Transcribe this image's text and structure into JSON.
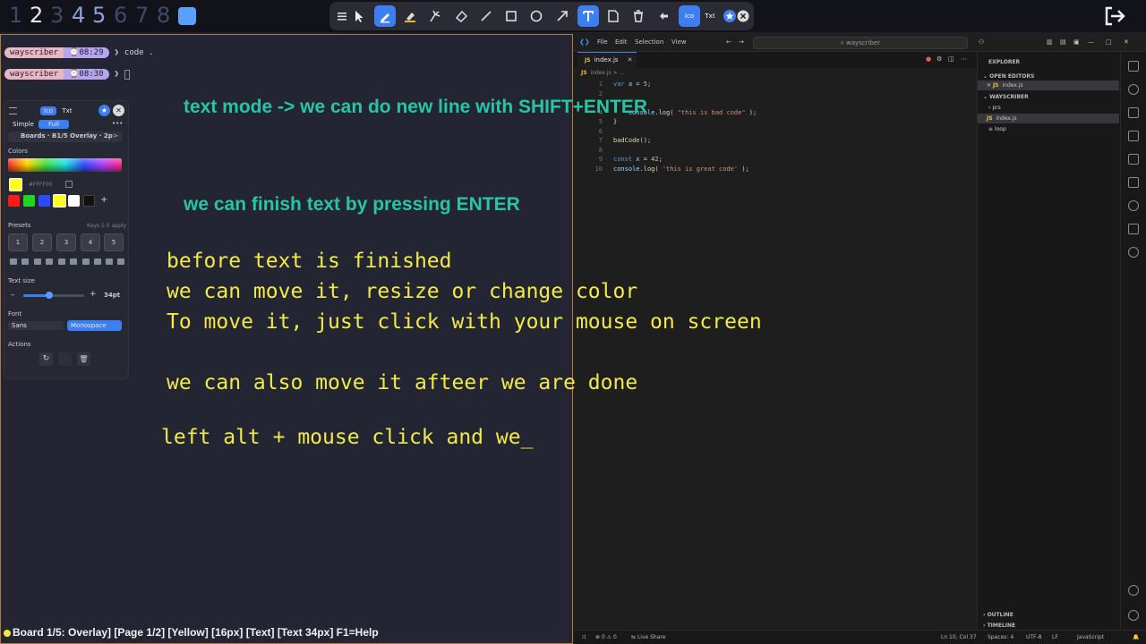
{
  "workspaces": {
    "items": [
      "1",
      "2",
      "3",
      "4",
      "5",
      "6",
      "7",
      "8"
    ],
    "active": "2"
  },
  "toolbar": {
    "icon_mode_label": "Ico",
    "text_mode_label": "Txt"
  },
  "terminal": {
    "host": "wayscriber",
    "rows": [
      {
        "time": "08:29",
        "command": "code ."
      },
      {
        "time": "08:30",
        "command": ""
      }
    ]
  },
  "annotations": {
    "teal": [
      "text mode -> we can do new line with SHIFT+ENTER",
      "we can finish text by pressing ENTER"
    ],
    "yellow": [
      "before text is finished",
      "we can move it, resize or change color",
      "To move it, just click with your mouse on screen",
      "we can also move it afteer we are done",
      "left alt + mouse click and we_"
    ]
  },
  "panel": {
    "tab_icons": "Ico",
    "tab_text": "Txt",
    "mode_simple": "Simple",
    "mode_full": "Full",
    "board_label": "Boards · B1/5 Overlay · 2p",
    "colors_title": "Colors",
    "hex_value": "#FFFF00",
    "presets_title": "Presets",
    "presets_hint": "Keys 1-5 apply",
    "preset_labels": [
      "1",
      "2",
      "3",
      "4",
      "5"
    ],
    "text_size_title": "Text size",
    "text_size_value": "34pt",
    "font_title": "Font",
    "font_sans": "Sans",
    "font_mono": "Monospace",
    "actions_title": "Actions",
    "swatch_colors": [
      "#ff1a1a",
      "#22d422",
      "#2a4cff",
      "#ffff22",
      "#ffffff",
      "#111111"
    ]
  },
  "vscode": {
    "menu": [
      "File",
      "Edit",
      "Selection",
      "View"
    ],
    "search": "wayscriber",
    "tab": "index.js",
    "breadcrumb": "index.js > ...",
    "lines": [
      {
        "n": "1",
        "code": [
          [
            "kw",
            "var "
          ],
          [
            "id",
            "a"
          ],
          [
            "pl",
            " = "
          ],
          [
            "num",
            "5"
          ],
          [
            "pl",
            ";"
          ]
        ]
      },
      {
        "n": "2",
        "code": []
      },
      {
        "n": "3",
        "code": []
      },
      {
        "n": "4",
        "code": [
          [
            "pl",
            "    "
          ],
          [
            "id",
            "console"
          ],
          [
            "pl",
            "."
          ],
          [
            "fn",
            "log"
          ],
          [
            "pl",
            "( "
          ],
          [
            "str",
            "\"this is bad code\""
          ],
          [
            "pl",
            " );"
          ]
        ]
      },
      {
        "n": "5",
        "code": [
          [
            "pl",
            "}"
          ]
        ]
      },
      {
        "n": "6",
        "code": []
      },
      {
        "n": "7",
        "code": [
          [
            "fn",
            "badCode"
          ],
          [
            "pl",
            "();"
          ]
        ]
      },
      {
        "n": "8",
        "code": []
      },
      {
        "n": "9",
        "code": [
          [
            "kw",
            "const "
          ],
          [
            "id",
            "x"
          ],
          [
            "pl",
            " = "
          ],
          [
            "num",
            "42"
          ],
          [
            "pl",
            ";"
          ]
        ]
      },
      {
        "n": "10",
        "code": [
          [
            "id",
            "console"
          ],
          [
            "pl",
            "."
          ],
          [
            "fn",
            "log"
          ],
          [
            "pl",
            "( "
          ],
          [
            "str",
            "'this is great code'"
          ],
          [
            "pl",
            " );"
          ]
        ]
      }
    ],
    "explorer": {
      "title": "EXPLORER",
      "open_editors": "OPEN EDITORS",
      "open_file": "index.js",
      "folder": "WAYSCRIBER",
      "items": [
        "prs",
        "index.js",
        "loop"
      ],
      "outline": "OUTLINE",
      "timeline": "TIMELINE"
    },
    "status": {
      "errors": "0",
      "warnings": "0",
      "live_share": "Live Share",
      "position": "Ln 10, Col 37",
      "spaces": "Spaces: 4",
      "encoding": "UTF-8",
      "eol": "LF",
      "language": "JavaScript"
    }
  },
  "overlay_status": "Board 1/5: Overlay] [Page 1/2] [Yellow] [16px] [Text] [Text 34px]  F1=Help"
}
